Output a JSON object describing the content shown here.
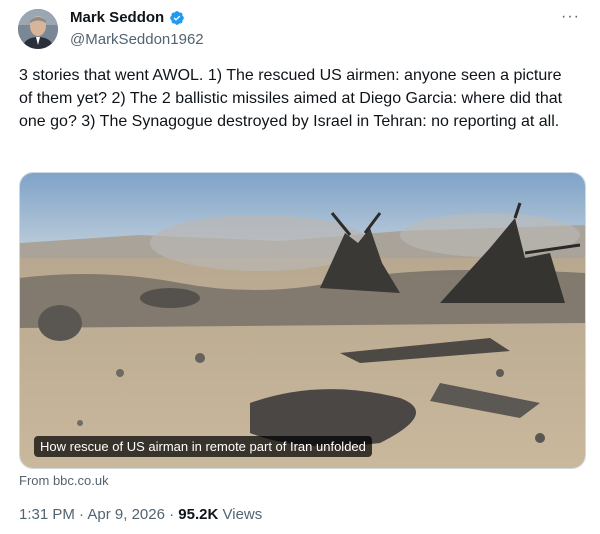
{
  "author": {
    "name": "Mark Seddon",
    "handle": "@MarkSeddon1962"
  },
  "more_label": "···",
  "tweet": {
    "text": "3 stories that went AWOL. 1) The rescued US airmen: anyone seen a picture of them yet? 2) The 2 ballistic missiles aimed at Diego Garcia: where did that one go? 3) The Synagogue destroyed by Israel in Tehran: no reporting at all."
  },
  "media": {
    "caption": "How rescue of US airman in remote part of Iran unfolded",
    "source": "From bbc.co.uk"
  },
  "meta": {
    "time": "1:31 PM",
    "separator": "·",
    "date": "Apr 9, 2026",
    "views_count": "95.2K",
    "views_label": "Views"
  },
  "colors": {
    "verified": "#1d9bf0",
    "secondary_text": "#536471",
    "primary_text": "#0f1419"
  }
}
